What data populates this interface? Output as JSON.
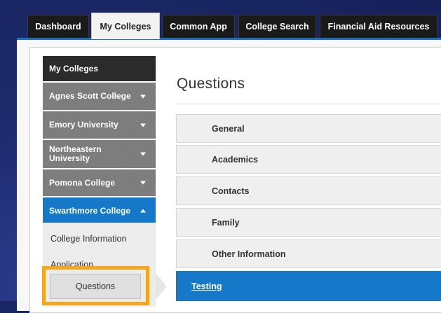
{
  "tabs": [
    {
      "label": "Dashboard",
      "active": false
    },
    {
      "label": "My Colleges",
      "active": true
    },
    {
      "label": "Common App",
      "active": false
    },
    {
      "label": "College Search",
      "active": false
    },
    {
      "label": "Financial Aid Resources",
      "active": false
    }
  ],
  "sidebar": {
    "header": "My Colleges",
    "colleges": [
      {
        "label": "Agnes Scott College",
        "expanded": false
      },
      {
        "label": "Emory University",
        "expanded": false
      },
      {
        "label": "Northeastern University",
        "expanded": false
      },
      {
        "label": "Pomona College",
        "expanded": false
      },
      {
        "label": "Swarthmore College",
        "expanded": true
      }
    ],
    "sub_items": [
      {
        "label": "College Information"
      },
      {
        "label": "Application"
      },
      {
        "label": "Questions",
        "selected": true
      }
    ]
  },
  "main": {
    "title": "Questions",
    "sections": [
      {
        "label": "General"
      },
      {
        "label": "Academics"
      },
      {
        "label": "Contacts"
      },
      {
        "label": "Family"
      },
      {
        "label": "Other Information"
      },
      {
        "label": "Testing",
        "active": true
      }
    ]
  },
  "colors": {
    "accent_blue": "#1578c8",
    "highlight_orange": "#f3a81c",
    "tab_dark": "#1a1a1a"
  },
  "icons": {
    "collapsed": "chevron-down-icon",
    "expanded": "chevron-up-icon"
  }
}
